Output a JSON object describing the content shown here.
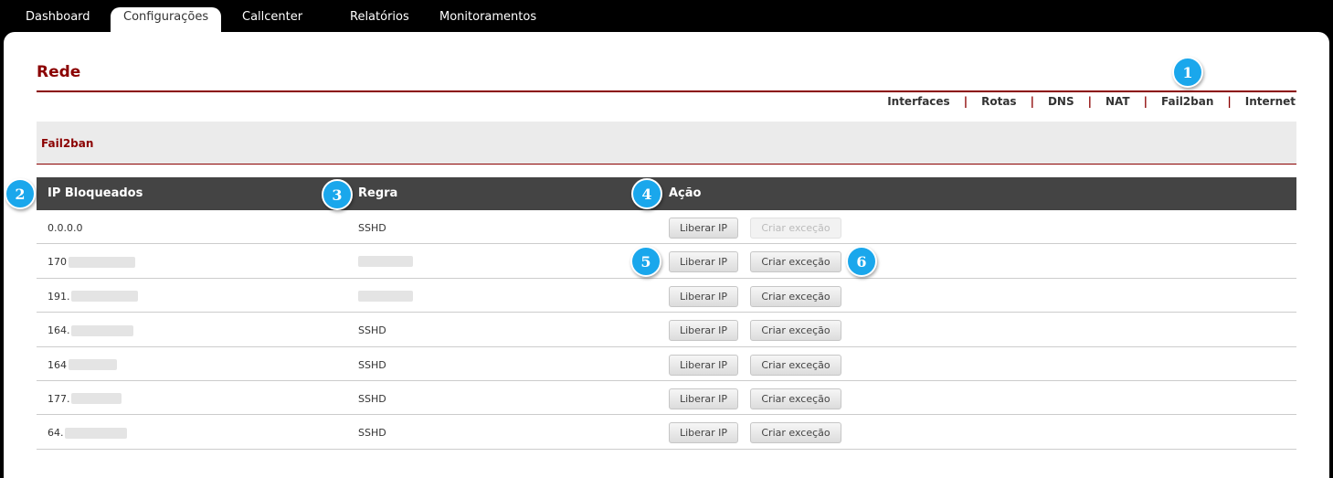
{
  "topnav": {
    "tabs": [
      {
        "label": "Dashboard"
      },
      {
        "label": "Configurações"
      },
      {
        "label": "Callcenter"
      },
      {
        "label": "Relatórios"
      },
      {
        "label": "Monitoramentos"
      }
    ],
    "active_tab": "Configurações"
  },
  "page": {
    "title": "Rede"
  },
  "subnav": {
    "links": [
      "Interfaces",
      "Rotas",
      "DNS",
      "NAT",
      "Fail2ban",
      "Internet"
    ],
    "separator": "|"
  },
  "section": {
    "title": "Fail2ban"
  },
  "table": {
    "headers": [
      "IP Bloqueados",
      "Regra",
      "Ação"
    ],
    "rows": [
      {
        "ip": "0.0.0.0",
        "rule": "SSHD",
        "release_label": "Liberar IP",
        "exception_label": "Criar exceção",
        "exception_disabled": true
      },
      {
        "ip": "170",
        "rule": "",
        "release_label": "Liberar IP",
        "exception_label": "Criar exceção",
        "exception_disabled": false
      },
      {
        "ip": "191.",
        "rule": "",
        "release_label": "Liberar IP",
        "exception_label": "Criar exceção",
        "exception_disabled": false
      },
      {
        "ip": "164.",
        "rule": "SSHD",
        "release_label": "Liberar IP",
        "exception_label": "Criar exceção",
        "exception_disabled": false
      },
      {
        "ip": "164",
        "rule": "SSHD",
        "release_label": "Liberar IP",
        "exception_label": "Criar exceção",
        "exception_disabled": false
      },
      {
        "ip": "177.",
        "rule": "SSHD",
        "release_label": "Liberar IP",
        "exception_label": "Criar exceção",
        "exception_disabled": false
      },
      {
        "ip": "64.",
        "rule": "SSHD",
        "release_label": "Liberar IP",
        "exception_label": "Criar exceção",
        "exception_disabled": false
      }
    ]
  },
  "annotations": [
    "1",
    "2",
    "3",
    "4",
    "5",
    "6"
  ],
  "colors": {
    "brand": "#8b0000",
    "header_bg": "#444444",
    "badge": "#1aa7ec"
  }
}
